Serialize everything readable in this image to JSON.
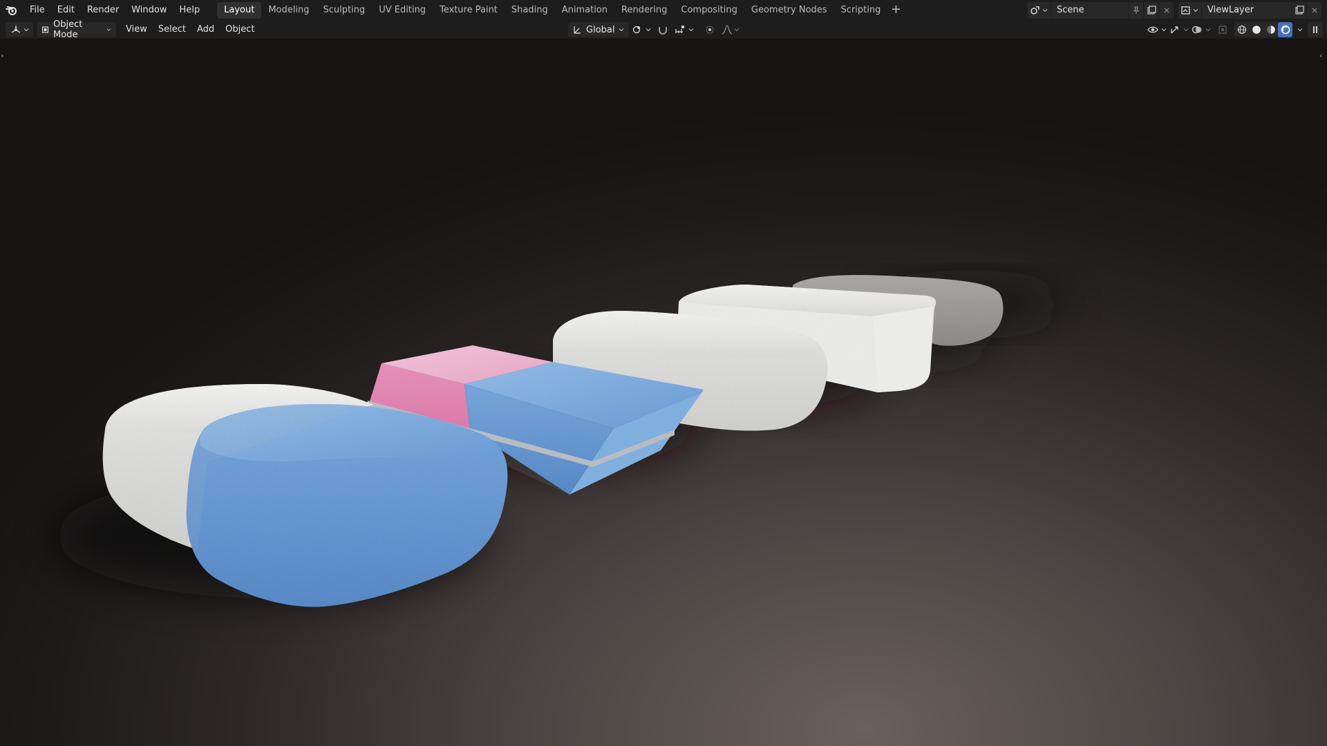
{
  "menu": [
    "File",
    "Edit",
    "Render",
    "Window",
    "Help"
  ],
  "tabs": [
    "Layout",
    "Modeling",
    "Sculpting",
    "UV Editing",
    "Texture Paint",
    "Shading",
    "Animation",
    "Rendering",
    "Compositing",
    "Geometry Nodes",
    "Scripting"
  ],
  "active_tab": "Layout",
  "scene": {
    "name": "Scene"
  },
  "view_layer": {
    "name": "ViewLayer"
  },
  "header": {
    "mode": "Object Mode",
    "menus": [
      "View",
      "Select",
      "Add",
      "Object"
    ],
    "orientation": "Global"
  },
  "viewport_shading": {
    "active": "rendered"
  },
  "colors": {
    "accent": "#4772b3",
    "topbar_bg": "#1d1d1d",
    "button_bg": "#282828",
    "eraser_blue": "#6fa3dc",
    "eraser_pink": "#f1a9cc",
    "eraser_white": "#ededed",
    "eraser_grey": "#9a9896"
  },
  "icons": [
    "blender-logo-icon",
    "plus-icon",
    "editor-type-icon",
    "object-mode-icon",
    "transform-orientation-icon",
    "pivot-icon",
    "snap-icon",
    "snap-increment-icon",
    "proportional-edit-icon",
    "falloff-icon",
    "visibility-icon",
    "gizmo-icon",
    "overlay-icon",
    "xray-icon",
    "wireframe-shading-icon",
    "solid-shading-icon",
    "material-shading-icon",
    "rendered-shading-icon"
  ]
}
